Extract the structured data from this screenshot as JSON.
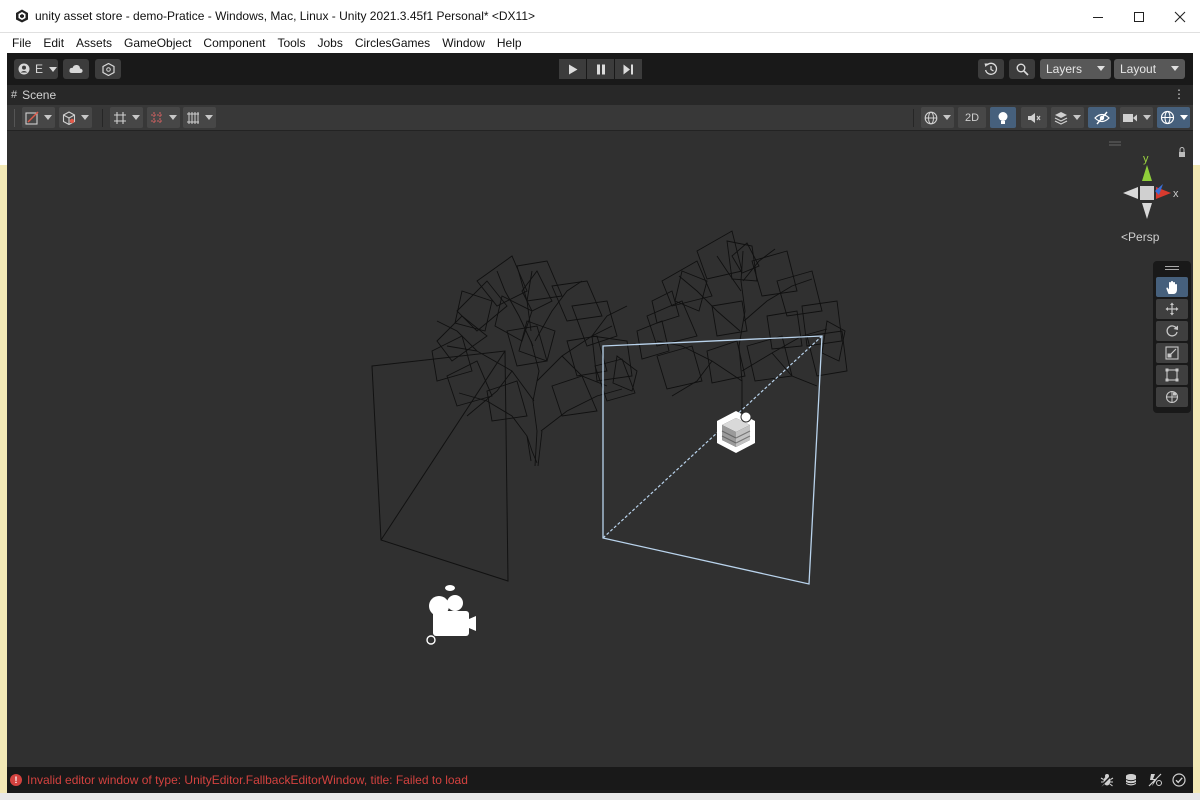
{
  "window": {
    "title": "unity asset store - demo-Pratice - Windows, Mac, Linux - Unity 2021.3.45f1 Personal* <DX11>"
  },
  "menu": [
    "File",
    "Edit",
    "Assets",
    "GameObject",
    "Component",
    "Tools",
    "Jobs",
    "CirclesGames",
    "Window",
    "Help"
  ],
  "toolbar": {
    "account_label": "E",
    "layers_label": "Layers",
    "layout_label": "Layout"
  },
  "scene_tab": {
    "label": "Scene"
  },
  "scene_toolbar": {
    "mode_2d": "2D"
  },
  "viewport": {
    "projection_label": "Persp",
    "gizmo_axes": {
      "x": "x",
      "y": "y"
    }
  },
  "status": {
    "message": "Invalid editor window of type: UnityEditor.FallbackEditorWindow, title: Failed to load"
  },
  "colors": {
    "accent": "#46607c",
    "error": "#d3423f",
    "viewport_bg": "#303030"
  }
}
